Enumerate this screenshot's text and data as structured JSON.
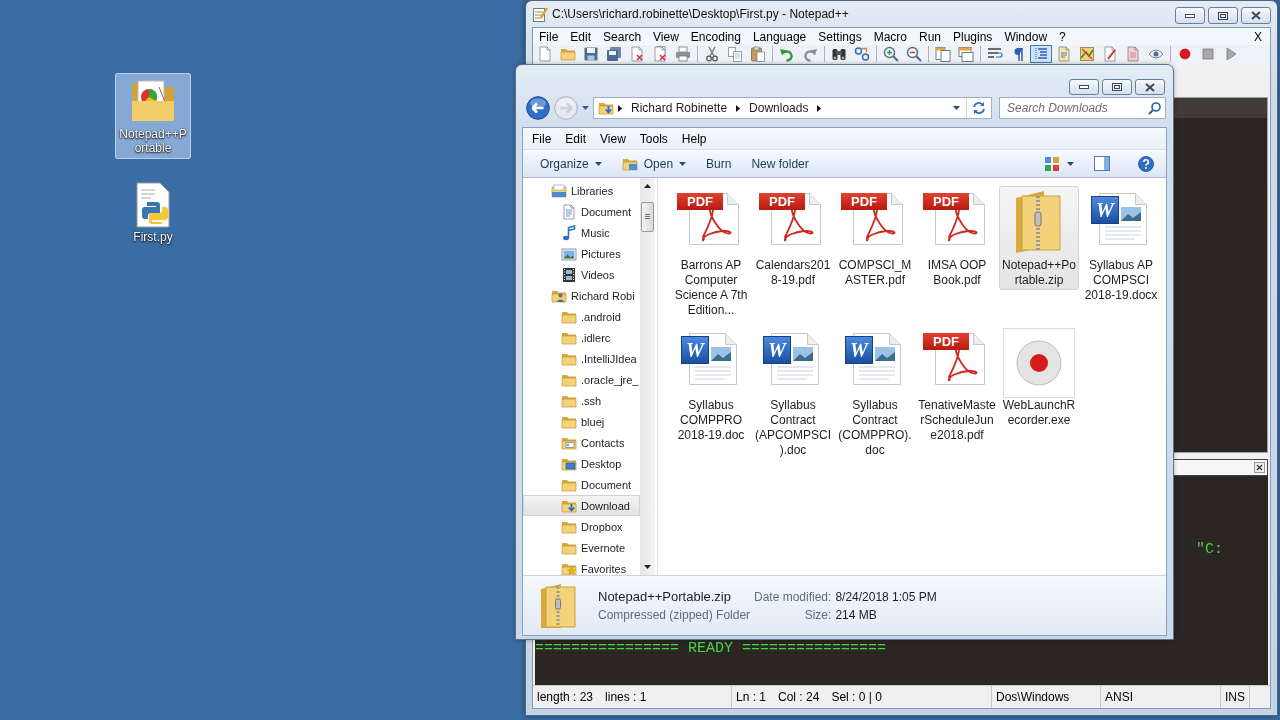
{
  "desktop": {
    "icons": [
      {
        "label": "Notepad++Portable",
        "kind": "folder",
        "selected": true
      },
      {
        "label": "First.py",
        "kind": "python",
        "selected": false
      }
    ]
  },
  "notepad": {
    "title": "C:\\Users\\richard.robinette\\Desktop\\First.py - Notepad++",
    "menu": [
      "File",
      "Edit",
      "Search",
      "View",
      "Encoding",
      "Language",
      "Settings",
      "Macro",
      "Run",
      "Plugins",
      "Window",
      "?"
    ],
    "menu_close": "X",
    "toolbar": [
      [
        {
          "kind": "new",
          "on": false
        },
        {
          "kind": "open",
          "on": false
        },
        {
          "kind": "save",
          "on": false
        },
        {
          "kind": "save_all",
          "on": false
        },
        {
          "kind": "close",
          "on": false
        },
        {
          "kind": "close_all",
          "on": false
        },
        {
          "kind": "print",
          "on": false
        }
      ],
      [
        {
          "kind": "cut",
          "on": false
        },
        {
          "kind": "copy",
          "on": false
        },
        {
          "kind": "paste",
          "on": false
        }
      ],
      [
        {
          "kind": "undo",
          "on": false
        },
        {
          "kind": "redo",
          "on": false
        }
      ],
      [
        {
          "kind": "find",
          "on": false
        },
        {
          "kind": "replace",
          "on": false
        }
      ],
      [
        {
          "kind": "zoom_in",
          "on": false
        },
        {
          "kind": "zoom_out",
          "on": false
        }
      ],
      [
        {
          "kind": "sync_v",
          "on": false
        },
        {
          "kind": "sync_h",
          "on": false
        }
      ],
      [
        {
          "kind": "wrap",
          "on": false
        },
        {
          "kind": "all_chars",
          "on": false
        },
        {
          "kind": "indent_guide",
          "on": true
        },
        {
          "kind": "lang",
          "on": false
        },
        {
          "kind": "doc_map",
          "on": false
        },
        {
          "kind": "func_list",
          "on": false
        },
        {
          "kind": "folder_ws",
          "on": false
        },
        {
          "kind": "monitor",
          "on": false
        }
      ],
      [
        {
          "kind": "record",
          "on": false
        },
        {
          "kind": "stop",
          "on": false
        },
        {
          "kind": "play",
          "on": false
        }
      ]
    ],
    "console": [
      "\"C:",
      "================ READY ================"
    ],
    "status_bar": [
      [
        "length : 23",
        "lines : 1"
      ],
      [
        "Ln : 1",
        "Col : 24",
        "Sel : 0 | 0"
      ],
      [
        "Dos\\Windows"
      ],
      [
        "ANSI"
      ],
      [
        "INS"
      ]
    ]
  },
  "explorer": {
    "nav_buttons": [
      {
        "kind": "back",
        "disabled": false
      },
      {
        "kind": "forward",
        "disabled": true
      }
    ],
    "breadcrumb": [
      "Richard Robinette",
      "Downloads"
    ],
    "search": {
      "placeholder": "Search Downloads"
    },
    "menu": [
      "File",
      "Edit",
      "View",
      "Tools",
      "Help"
    ],
    "commands": [
      {
        "label": "Organize",
        "kind": "menu"
      },
      {
        "label": "Open",
        "kind": "open"
      },
      {
        "label": "Burn",
        "kind": "plain"
      },
      {
        "label": "New folder",
        "kind": "plain"
      }
    ],
    "nav": [
      {
        "label": "Libraries",
        "kind": "library",
        "selected": false,
        "children": [
          {
            "label": "Document",
            "kind": "documents",
            "selected": false
          },
          {
            "label": "Music",
            "kind": "music",
            "selected": false
          },
          {
            "label": "Pictures",
            "kind": "pictures",
            "selected": false
          },
          {
            "label": "Videos",
            "kind": "videos",
            "selected": false
          }
        ]
      },
      {
        "label": "Richard Robi",
        "kind": "user",
        "selected": false,
        "children": [
          {
            "label": ".android",
            "kind": "folder",
            "selected": false
          },
          {
            "label": ".idlerc",
            "kind": "folder",
            "selected": false
          },
          {
            "label": ".IntelliJIdea",
            "kind": "folder",
            "selected": false
          },
          {
            "label": ".oracle_jre_",
            "kind": "folder",
            "selected": false
          },
          {
            "label": ".ssh",
            "kind": "folder",
            "selected": false
          },
          {
            "label": "bluej",
            "kind": "folder",
            "selected": false
          },
          {
            "label": "Contacts",
            "kind": "contacts",
            "selected": false
          },
          {
            "label": "Desktop",
            "kind": "desktop",
            "selected": false
          },
          {
            "label": "Document",
            "kind": "folder",
            "selected": false
          },
          {
            "label": "Download",
            "kind": "downloads",
            "selected": true
          },
          {
            "label": "Dropbox",
            "kind": "folder",
            "selected": false
          },
          {
            "label": "Evernote",
            "kind": "folder",
            "selected": false
          },
          {
            "label": "Favorites",
            "kind": "favorites",
            "selected": false
          }
        ]
      }
    ],
    "files": [
      {
        "name": "Barrons AP Computer Science A 7th Edition...",
        "kind": "pdf",
        "type_label": "PDF",
        "selected": false
      },
      {
        "name": "Calendars2018-19.pdf",
        "kind": "pdf",
        "type_label": "PDF",
        "selected": false
      },
      {
        "name": "COMPSCI_MASTER.pdf",
        "kind": "pdf",
        "type_label": "PDF",
        "selected": false
      },
      {
        "name": "IMSA OOP Book.pdf",
        "kind": "pdf",
        "type_label": "PDF",
        "selected": false
      },
      {
        "name": "Notepad++Portable.zip",
        "kind": "zip",
        "selected": true
      },
      {
        "name": "Syllabus AP COMPSCI 2018-19.docx",
        "kind": "word",
        "type_label": "W",
        "selected": false
      },
      {
        "name": "Syllabus COMPPRO 2018-19.doc",
        "kind": "word",
        "type_label": "W",
        "selected": false
      },
      {
        "name": "Syllabus Contract (APCOMPSCI).doc",
        "kind": "word",
        "type_label": "W",
        "selected": false
      },
      {
        "name": "Syllabus Contract (COMPPRO).doc",
        "kind": "word",
        "type_label": "W",
        "selected": false
      },
      {
        "name": "TenativeMasterScheduleJune2018.pdf",
        "kind": "pdf",
        "type_label": "PDF",
        "selected": false
      },
      {
        "name": "WebLaunchRecorder.exe",
        "kind": "exe",
        "selected": false
      }
    ],
    "details": {
      "name": "Notepad++Portable.zip",
      "type": "Compressed (zipped) Folder",
      "fields": [
        {
          "label": "Date modified:",
          "value": "8/24/2018 1:05 PM"
        },
        {
          "label": "Size:",
          "value": "214 MB"
        }
      ]
    }
  }
}
